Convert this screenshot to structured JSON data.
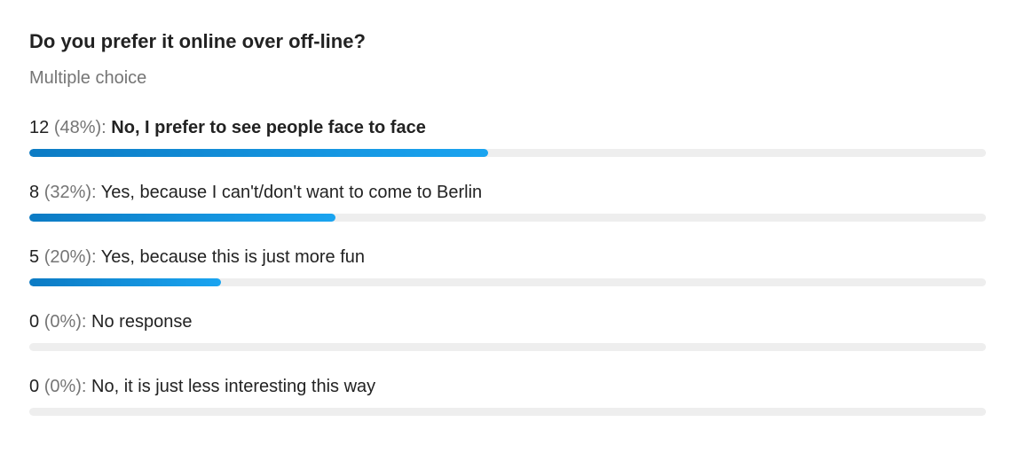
{
  "poll": {
    "title": "Do you prefer it online over off-line?",
    "subtitle": "Multiple choice"
  },
  "chart_data": {
    "type": "bar",
    "title": "Do you prefer it online over off-line?",
    "subtitle": "Multiple choice",
    "orientation": "horizontal",
    "colors": {
      "fill_start": "#0c7bc4",
      "fill_end": "#1aa4f0",
      "track": "#eeeeee"
    },
    "options": [
      {
        "count": "12",
        "percent_label": "(48%):",
        "label": "No, I prefer to see people face to face",
        "percent": 48,
        "leader": true
      },
      {
        "count": "8",
        "percent_label": "(32%):",
        "label": "Yes, because I can't/don't want to come to Berlin",
        "percent": 32,
        "leader": false
      },
      {
        "count": "5",
        "percent_label": "(20%):",
        "label": "Yes, because this is just more fun",
        "percent": 20,
        "leader": false
      },
      {
        "count": "0",
        "percent_label": "(0%):",
        "label": "No response",
        "percent": 0,
        "leader": false
      },
      {
        "count": "0",
        "percent_label": "(0%):",
        "label": "No, it is just less interesting this way",
        "percent": 0,
        "leader": false
      }
    ]
  }
}
